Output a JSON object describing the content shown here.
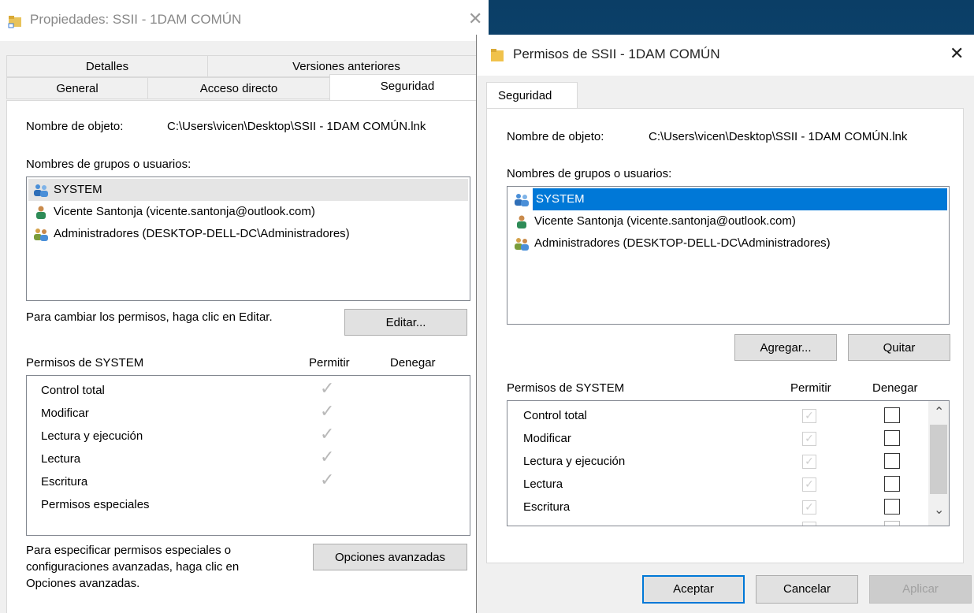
{
  "back_dialog": {
    "title": "Propiedades: SSII - 1DAM COMÚN",
    "close_glyph": "✕",
    "tabs_row1": [
      "Detalles",
      "Versiones anteriores"
    ],
    "tabs_row2": [
      "General",
      "Acceso directo",
      "Seguridad"
    ],
    "object_name_label": "Nombre de objeto:",
    "object_name_value": "C:\\Users\\vicen\\Desktop\\SSII - 1DAM COMÚN.lnk",
    "groups_label": "Nombres de grupos o usuarios:",
    "groups": [
      {
        "name": "SYSTEM",
        "icon": "group-icon"
      },
      {
        "name": "Vicente Santonja (vicente.santonja@outlook.com)",
        "icon": "user-icon"
      },
      {
        "name": "Administradores (DESKTOP-DELL-DC\\Administradores)",
        "icon": "group-icon"
      }
    ],
    "change_hint": "Para cambiar los permisos, haga clic en Editar.",
    "edit_button": "Editar...",
    "perms_label": "Permisos de SYSTEM",
    "allow_header": "Permitir",
    "deny_header": "Denegar",
    "permissions": [
      {
        "name": "Control total",
        "allow": true
      },
      {
        "name": "Modificar",
        "allow": true
      },
      {
        "name": "Lectura y ejecución",
        "allow": true
      },
      {
        "name": "Lectura",
        "allow": true
      },
      {
        "name": "Escritura",
        "allow": true
      },
      {
        "name": "Permisos especiales",
        "allow": false
      }
    ],
    "advanced_hint_1": "Para especificar permisos especiales o",
    "advanced_hint_2": "configuraciones avanzadas, haga clic en",
    "advanced_hint_3": "Opciones avanzadas.",
    "advanced_button": "Opciones avanzadas",
    "check_glyph": "✓"
  },
  "front_dialog": {
    "title": "Permisos de SSII - 1DAM COMÚN",
    "close_glyph": "✕",
    "tab": "Seguridad",
    "object_name_label": "Nombre de objeto:",
    "object_name_value": "C:\\Users\\vicen\\Desktop\\SSII - 1DAM COMÚN.lnk",
    "groups_label": "Nombres de grupos o usuarios:",
    "groups": [
      {
        "name": "SYSTEM",
        "icon": "group-icon",
        "selected": true
      },
      {
        "name": "Vicente Santonja (vicente.santonja@outlook.com)",
        "icon": "user-icon"
      },
      {
        "name": "Administradores (DESKTOP-DELL-DC\\Administradores)",
        "icon": "group-icon"
      }
    ],
    "add_button": "Agregar...",
    "remove_button": "Quitar",
    "perms_label": "Permisos de SYSTEM",
    "allow_header": "Permitir",
    "deny_header": "Denegar",
    "permissions": [
      {
        "name": "Control total",
        "allow": true,
        "deny": false
      },
      {
        "name": "Modificar",
        "allow": true,
        "deny": false
      },
      {
        "name": "Lectura y ejecución",
        "allow": true,
        "deny": false
      },
      {
        "name": "Lectura",
        "allow": true,
        "deny": false
      },
      {
        "name": "Escritura",
        "allow": true,
        "deny": false
      }
    ],
    "scroll_up_glyph": "⌃",
    "scroll_down_glyph": "⌄",
    "ok_button": "Aceptar",
    "cancel_button": "Cancelar",
    "apply_button": "Aplicar",
    "check_glyph": "✓"
  },
  "colors": {
    "selection_blue": "#0078d7",
    "dialog_bg": "#f0f0f0",
    "desktop": "#0e4d7a"
  }
}
